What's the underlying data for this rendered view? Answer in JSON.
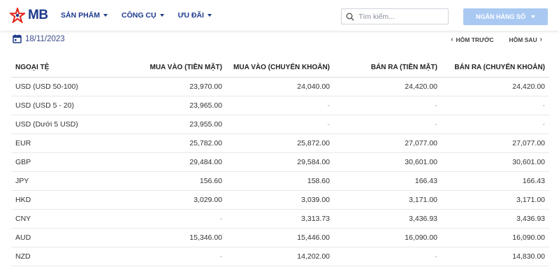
{
  "brand": {
    "logo_text": "MB",
    "accent": "#1d3a8c",
    "logo_red": "#e2231a"
  },
  "nav": [
    {
      "label": "SẢN PHẨM"
    },
    {
      "label": "CÔNG CỤ"
    },
    {
      "label": "ƯU ĐÃI"
    }
  ],
  "search": {
    "placeholder": "Tìm kiếm..."
  },
  "bank_button": {
    "label": "NGÂN HÀNG SỐ"
  },
  "date": {
    "value": "18/11/2023",
    "prev_label": "HÔM TRƯỚC",
    "next_label": "HÔM SAU"
  },
  "table": {
    "headers": [
      "NGOẠI TỆ",
      "MUA VÀO (TIỀN MẶT)",
      "MUA VÀO (CHUYỂN KHOẢN)",
      "BÁN RA (TIỀN MẶT)",
      "BÁN RA (CHUYỂN KHOẢN)"
    ],
    "rows": [
      [
        "USD (USD 50-100)",
        "23,970.00",
        "24,040.00",
        "24,420.00",
        "24,420.00"
      ],
      [
        "USD (USD 5 - 20)",
        "23,965.00",
        "-",
        "-",
        "-"
      ],
      [
        "USD (Dưới 5 USD)",
        "23,955.00",
        "-",
        "-",
        "-"
      ],
      [
        "EUR",
        "25,782.00",
        "25,872.00",
        "27,077.00",
        "27,077.00"
      ],
      [
        "GBP",
        "29,484.00",
        "29,584.00",
        "30,601.00",
        "30,601.00"
      ],
      [
        "JPY",
        "156.60",
        "158.60",
        "166.43",
        "166.43"
      ],
      [
        "HKD",
        "3,029.00",
        "3,039.00",
        "3,171.00",
        "3,171.00"
      ],
      [
        "CNY",
        "-",
        "3,313.73",
        "3,436.93",
        "3,436.93"
      ],
      [
        "AUD",
        "15,346.00",
        "15,446.00",
        "16,090.00",
        "16,090.00"
      ],
      [
        "NZD",
        "-",
        "14,202.00",
        "-",
        "14,830.00"
      ]
    ]
  }
}
